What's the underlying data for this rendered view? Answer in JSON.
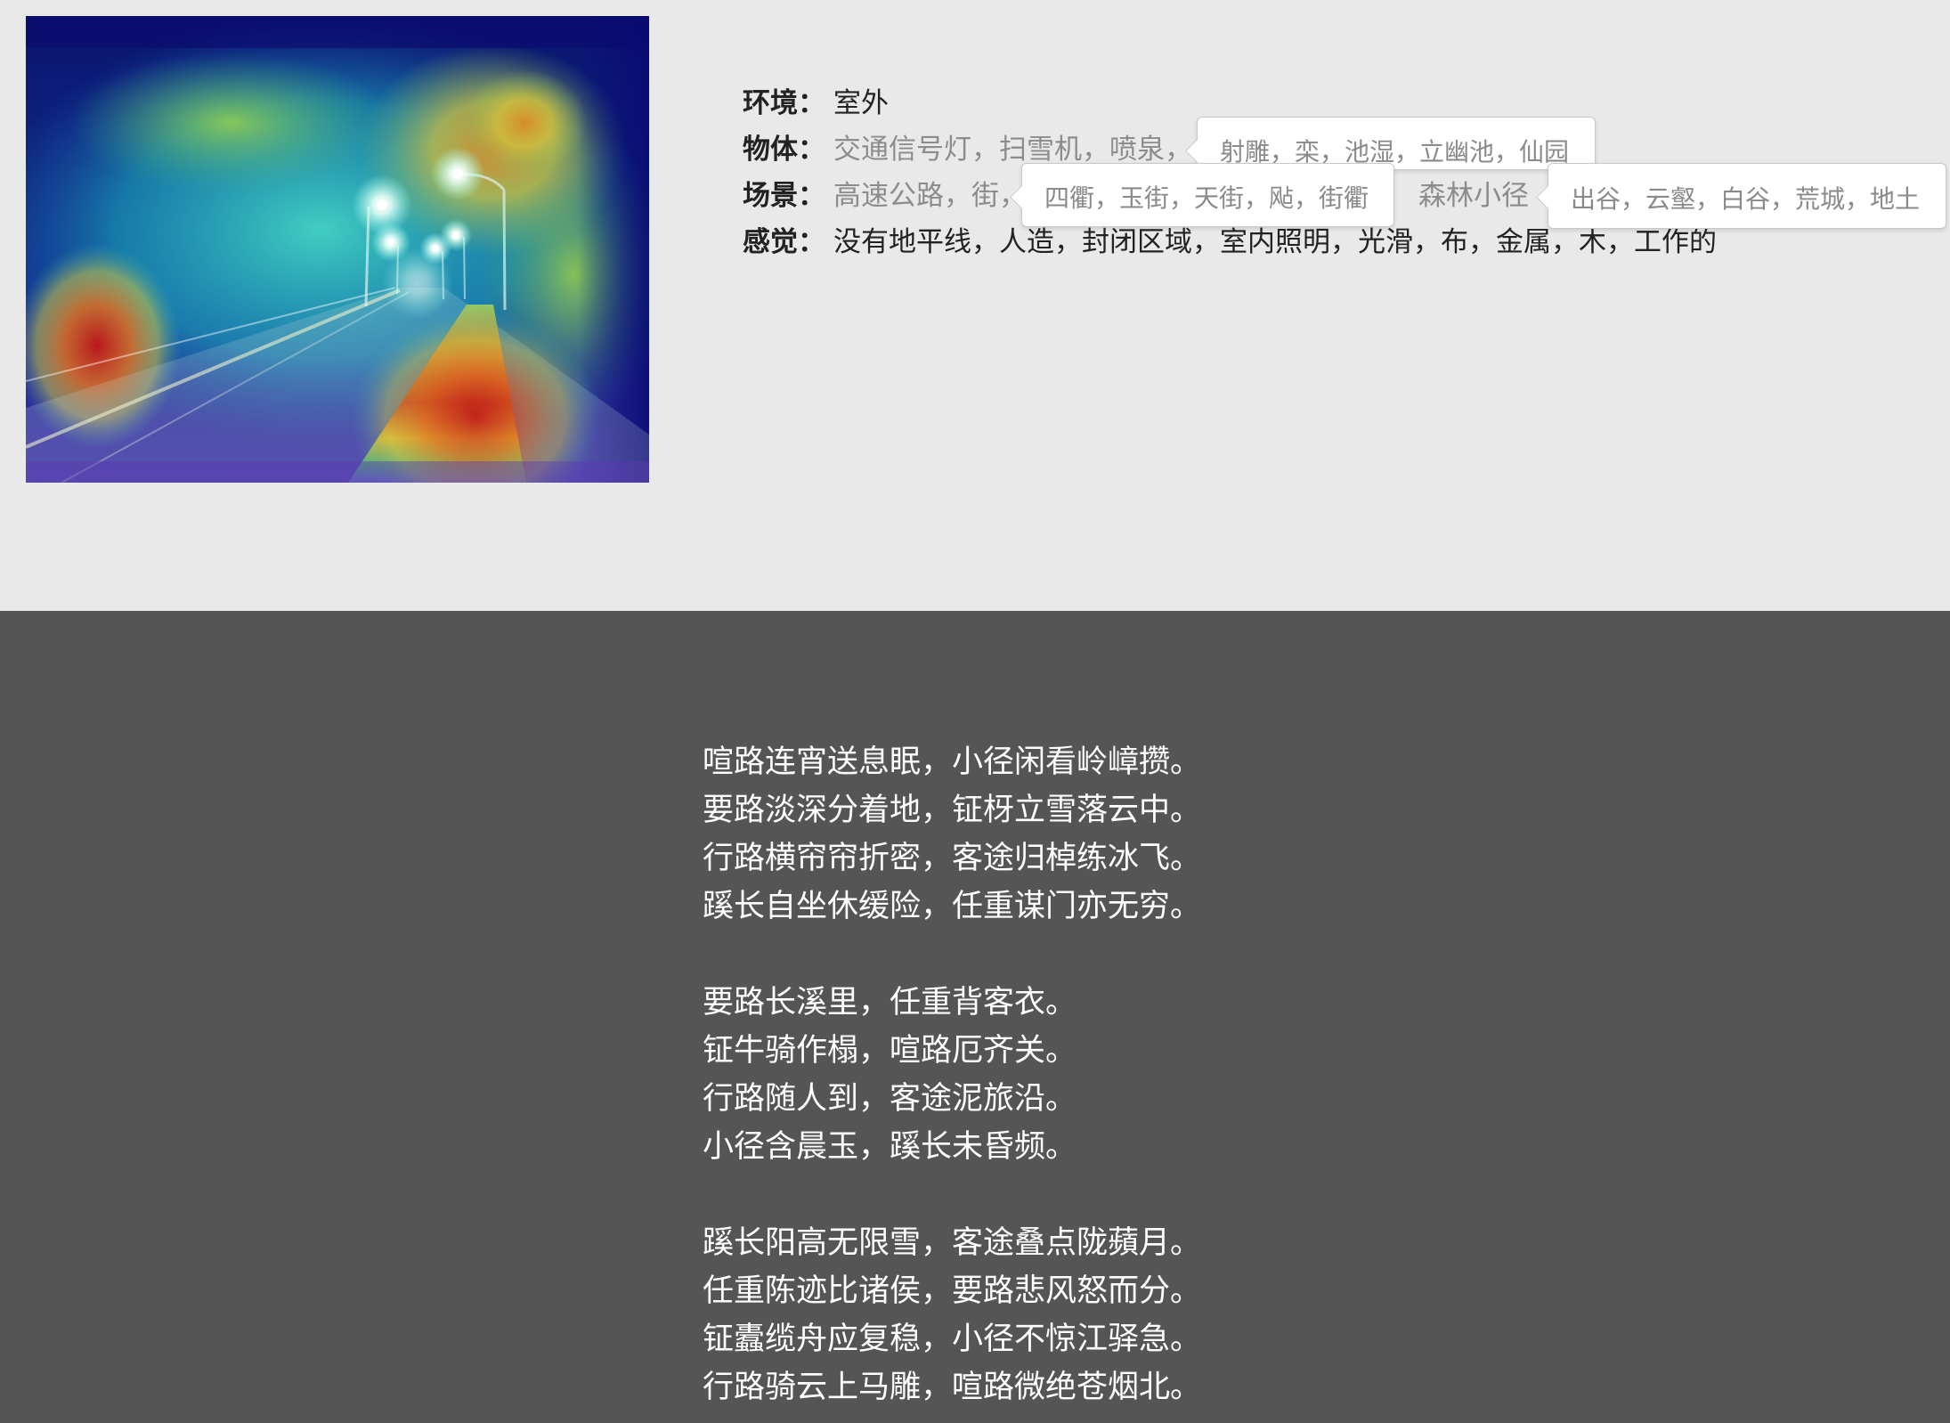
{
  "attributes": [
    {
      "label": "环境：",
      "value": "室外"
    },
    {
      "label": "物体：",
      "items": [
        "交通信号灯，",
        "扫雪机，",
        "喷泉，"
      ]
    },
    {
      "label": "场景：",
      "items": [
        "高速公路，",
        "街，",
        "森林小径"
      ]
    },
    {
      "label": "感觉：",
      "value": "没有地平线，人造，封闭区域，室内照明，光滑，布，金属，木，工作的"
    }
  ],
  "tooltips": [
    {
      "text": "射雕，栾，池湿，立幽池，仙园"
    },
    {
      "text": "四衢，玉街，天街，飐，街衢"
    },
    {
      "text": "出谷，云壑，白谷，荒城，地土"
    }
  ],
  "poem": {
    "stanzas": [
      {
        "lines": [
          "喧路连宵送息眠，小径闲看岭嶂攒。",
          "要路淡深分着地，钲枒立雪落云中。",
          "行路横帘帘折密，客途归棹练冰飞。",
          "蹊长自坐休缓险，任重谋门亦无穷。"
        ]
      },
      {
        "lines": [
          "要路长溪里，任重背客衣。",
          "钲牛骑作榻，喧路厄齐关。",
          "行路随人到，客途泥旅沿。",
          "小径含晨玉，蹊长未昏频。"
        ]
      },
      {
        "lines": [
          "蹊长阳高无限雪，客途叠点陇蘋月。",
          "任重陈迹比诸侯，要路悲风怒而分。",
          "钲蠹缆舟应复稳，小径不惊江驿急。",
          "行路骑云上马雕，喧路微绝苍烟北。"
        ]
      }
    ]
  },
  "colors": {
    "top_background": "#e9e9e9",
    "bottom_background": "#555555",
    "text": "#222222",
    "muted_text": "#8c8c8c",
    "poem_text": "#ffffff",
    "tooltip_background": "#ffffff"
  }
}
